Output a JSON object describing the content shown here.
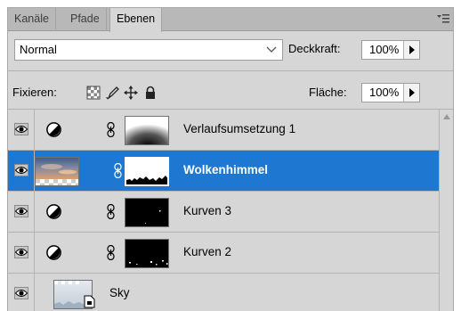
{
  "tabs": [
    {
      "label": "Kanäle",
      "active": false
    },
    {
      "label": "Pfade",
      "active": false
    },
    {
      "label": "Ebenen",
      "active": true
    }
  ],
  "blend_mode": {
    "selected": "Normal"
  },
  "opacity": {
    "label": "Deckkraft:",
    "value": "100%"
  },
  "locks": {
    "label": "Fixieren:",
    "icons": [
      "lock-transparent-pixels-icon",
      "lock-image-pixels-icon",
      "lock-position-icon",
      "lock-all-icon"
    ]
  },
  "fill": {
    "label": "Fläche:",
    "value": "100%"
  },
  "layers": [
    {
      "name": "Verlaufsumsetzung 1",
      "type": "gradient-map-adjustment",
      "visible": true,
      "selected": false
    },
    {
      "name": "Wolkenhimmel",
      "type": "image-with-mask",
      "visible": true,
      "selected": true
    },
    {
      "name": "Kurven 3",
      "type": "curves-adjustment",
      "visible": true,
      "selected": false
    },
    {
      "name": "Kurven 2",
      "type": "curves-adjustment",
      "visible": true,
      "selected": false
    },
    {
      "name": "Sky",
      "type": "smart-object",
      "visible": true,
      "selected": false
    }
  ],
  "colors": {
    "selection": "#1e78d1",
    "panel": "#d6d6d6",
    "tabbar": "#b8b8b8"
  }
}
